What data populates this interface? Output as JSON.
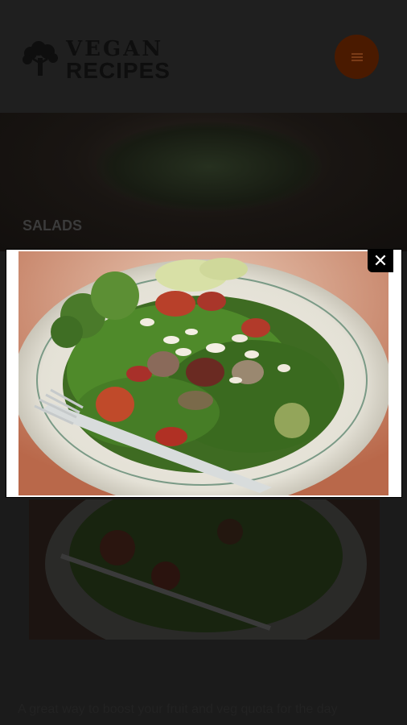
{
  "header": {
    "logo_line1": "VEGAN",
    "logo_line2": "RECIPES",
    "logo_icon": "broccoli-icon",
    "menu_icon": "hamburger-icon",
    "menu_button_color": "#4a1a00"
  },
  "section": {
    "label": "SALADS"
  },
  "lightbox": {
    "close_label": "✕",
    "photo_alt": "kale salad with broccoli, tomatoes and almonds on a white plate with a fork"
  },
  "article": {
    "intro": "A great way to boost your fruit and veg quota for the day"
  }
}
